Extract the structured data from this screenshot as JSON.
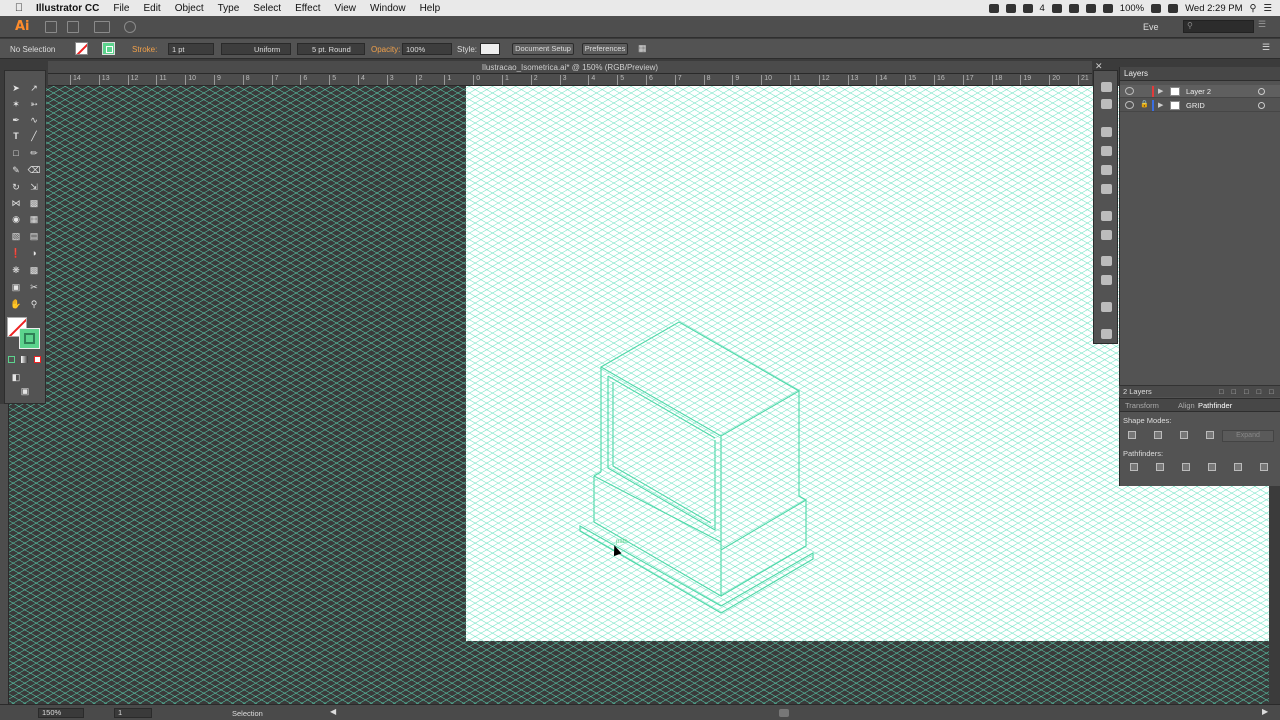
{
  "menubar": {
    "app_name": "Illustrator CC",
    "items": [
      "File",
      "Edit",
      "Object",
      "Type",
      "Select",
      "Effect",
      "View",
      "Window",
      "Help"
    ],
    "status_text": "100%",
    "clock": "Wed 2:29 PM",
    "badge": "4"
  },
  "appbar": {
    "logo": "Ai",
    "user": "Eve"
  },
  "control": {
    "selection": "No Selection",
    "stroke_label": "Stroke:",
    "stroke_weight": "1 pt",
    "profile": "Uniform",
    "brush": "5 pt. Round",
    "opacity_label": "Opacity:",
    "opacity": "100%",
    "style_label": "Style:",
    "document_setup": "Document Setup",
    "preferences": "Preferences"
  },
  "document": {
    "tab_title": "Ilustracao_Isometrica.ai* @ 150% (RGB/Preview)"
  },
  "ruler": {
    "ticks": [
      "14",
      "13",
      "12",
      "11",
      "10",
      "9",
      "8",
      "7",
      "6",
      "5",
      "4",
      "3",
      "2",
      "1",
      "0",
      "1",
      "2",
      "3",
      "4",
      "5",
      "6",
      "7",
      "8",
      "9",
      "10",
      "11",
      "12",
      "13",
      "14",
      "15",
      "16",
      "17",
      "18",
      "19",
      "20",
      "21"
    ]
  },
  "layers": {
    "title": "Layers",
    "rows": [
      {
        "name": "Layer 2",
        "color": "#e23a3a"
      },
      {
        "name": "GRID",
        "color": "#3a6ee2"
      }
    ],
    "count": "2 Layers"
  },
  "pathfinder": {
    "tabs": [
      "Transform",
      "Align",
      "Pathfinder"
    ],
    "shape_modes": "Shape Modes:",
    "pathfinders": "Pathfinders:",
    "expand": "Expand"
  },
  "status": {
    "zoom": "150%",
    "artboard": "1",
    "tool": "Selection"
  },
  "canvas": {
    "grid_color": "#5fe0bd",
    "art_color": "#4fd8a8",
    "cursor_hint": "path"
  }
}
